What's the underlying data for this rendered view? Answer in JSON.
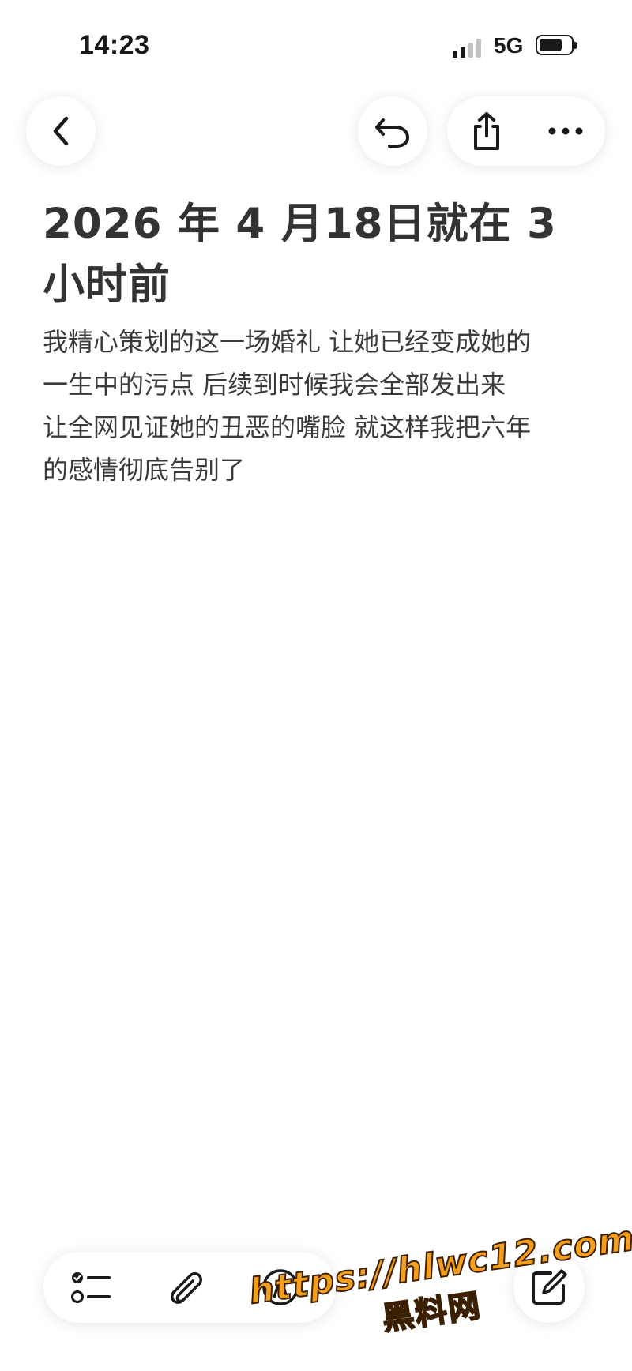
{
  "status_bar": {
    "time": "14:23",
    "network": "5G",
    "signal_bars_active": 2,
    "signal_bars_total": 4,
    "battery_level": 0.75
  },
  "nav": {
    "back_icon": "chevron-left-icon",
    "undo_icon": "undo-icon",
    "share_icon": "share-icon",
    "more_icon": "ellipsis-icon"
  },
  "note": {
    "title": "2026 年 4 月18日就在 3 小时前",
    "body_lines": [
      "我精心策划的这一场婚礼 让她已经变成她的",
      "一生中的污点  后续到时候我会全部发出来",
      "让全网见证她的丑恶的嘴脸 就这样我把六年",
      "的感情彻底告别了"
    ]
  },
  "toolbar": {
    "checklist_icon": "checklist-icon",
    "attach_icon": "paperclip-icon",
    "markup_icon": "markup-pen-icon",
    "compose_icon": "compose-icon"
  },
  "watermark": {
    "url": "https://hlwc12.com",
    "site": "黑料网"
  },
  "colors": {
    "background": "#ffffff",
    "text": "#333333",
    "watermark": "#f59e1b"
  }
}
